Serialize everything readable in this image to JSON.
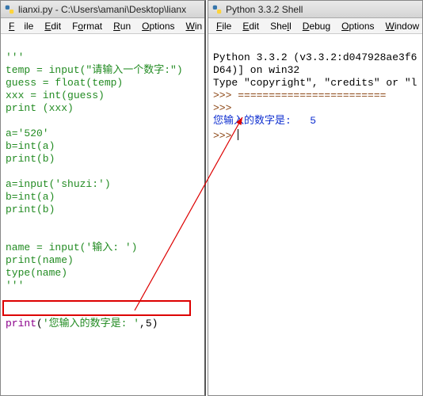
{
  "editor": {
    "title": "lianxi.py - C:\\Users\\amani\\Desktop\\lianx",
    "menu": {
      "file": "File",
      "edit": "Edit",
      "format": "Format",
      "run": "Run",
      "options": "Options",
      "window": "Win"
    },
    "code": {
      "l1": "'''",
      "l2": "temp = input(\"请输入一个数字:\")",
      "l3": "guess = float(temp)",
      "l4": "xxx = int(guess)",
      "l5": "print (xxx)",
      "l6": "",
      "l7": "a='520'",
      "l8": "b=int(a)",
      "l9": "print(b)",
      "l10": "",
      "l11": "a=input('shuzi:')",
      "l12": "b=int(a)",
      "l13": "print(b)",
      "l14": "",
      "l15": "",
      "l16": "name = input('输入: ')",
      "l17": "print(name)",
      "l18": "type(name)",
      "l19": "'''",
      "l20": "",
      "l21": "",
      "l22_a": "print",
      "l22_b": "(",
      "l22_c": "'您输入的数字是: '",
      "l22_d": ",5)"
    }
  },
  "shell": {
    "title": "Python 3.3.2 Shell",
    "menu": {
      "file": "File",
      "edit": "Edit",
      "shell": "Shell",
      "debug": "Debug",
      "options": "Options",
      "window": "Window"
    },
    "banner1": "Python 3.3.2 (v3.3.2:d047928ae3f6",
    "banner2": "D64)] on win32",
    "banner3": "Type \"copyright\", \"credits\" or \"l",
    "prompt1": ">>> ",
    "divider": "========================",
    "prompt2": ">>> ",
    "out_label": "您输入的数字是: ",
    "out_value": "5",
    "prompt3": ">>> "
  }
}
